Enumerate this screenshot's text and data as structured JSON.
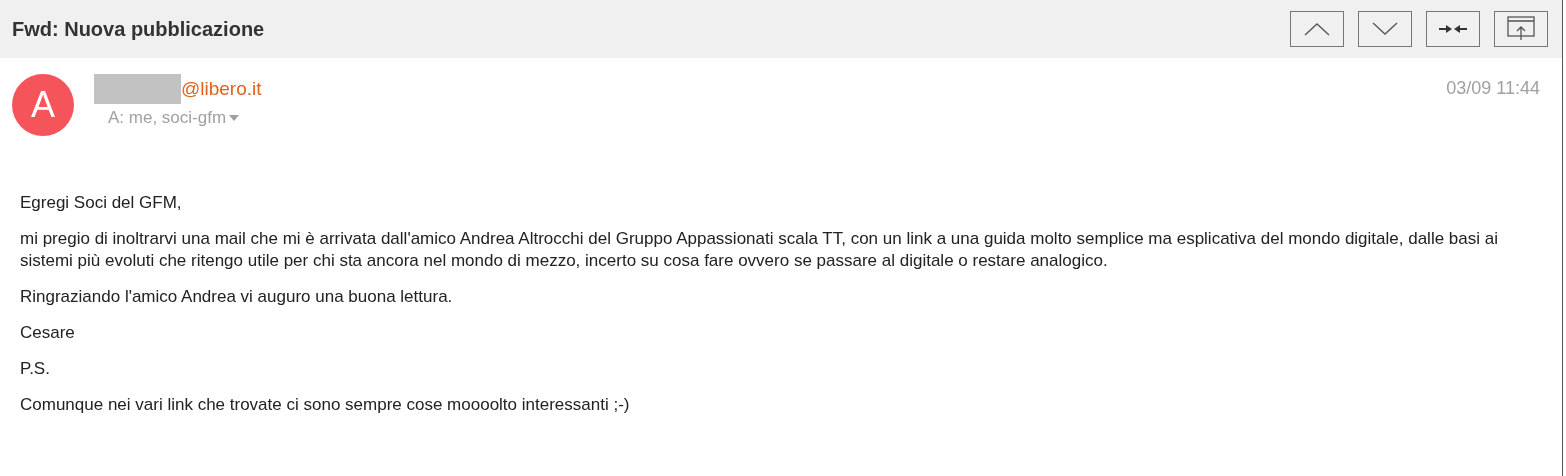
{
  "title": "Fwd: Nuova pubblicazione",
  "toolbar": [
    {
      "kind": "up"
    },
    {
      "kind": "down"
    },
    {
      "kind": "collapse"
    },
    {
      "kind": "popout"
    }
  ],
  "sender": {
    "avatar": "A",
    "email": "@libero.it",
    "recipients": "A: me, soci-gfm",
    "date": "03/09 11:44"
  },
  "body": [
    "Egregi Soci del GFM,",
    "mi pregio di inoltrarvi una mail che mi è arrivata dall'amico Andrea Altrocchi del Gruppo Appassionati scala TT, con un link a una guida molto semplice ma esplicativa del mondo digitale, dalle basi ai sistemi più evoluti che ritengo utile per chi sta ancora nel mondo di mezzo, incerto su cosa fare ovvero se passare al digitale o restare analogico.",
    "Ringraziando l'amico Andrea vi auguro una buona lettura.",
    "Cesare",
    "P.S.",
    "Comunque nei vari link che trovate ci sono sempre cose moooolto interessanti ;-)"
  ]
}
